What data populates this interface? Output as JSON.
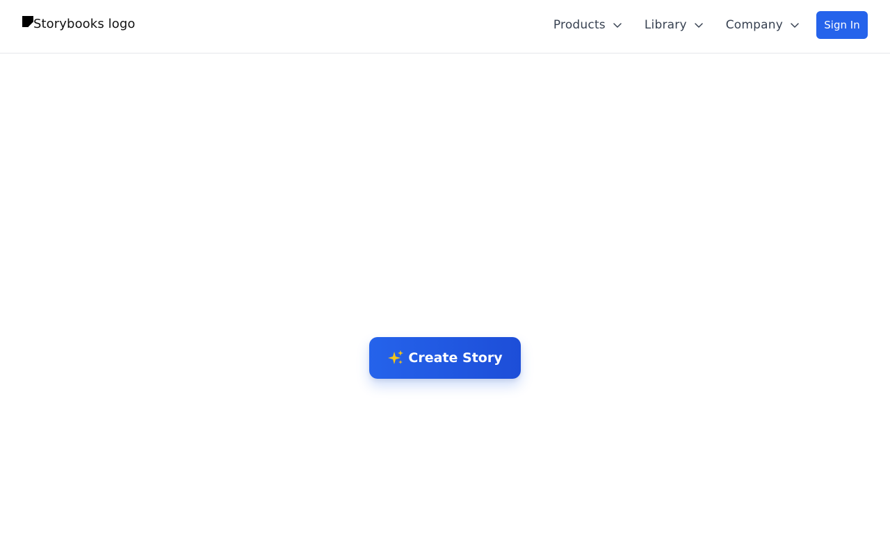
{
  "header": {
    "logo_alt": "Storybooks logo",
    "logo_icon": "broken-image-icon",
    "nav": [
      {
        "label": "Products",
        "icon": "chevron-down-icon"
      },
      {
        "label": "Library",
        "icon": "chevron-down-icon"
      },
      {
        "label": "Company",
        "icon": "chevron-down-icon"
      }
    ],
    "signin_label": "Sign In"
  },
  "main": {
    "cta_icon": "sparkles-icon",
    "cta_label": "Create Story"
  },
  "colors": {
    "accent": "#2563eb",
    "accent_dark": "#1d4ed8",
    "nav_text": "#374151",
    "border": "#e5e7eb",
    "sparkle": "#f5c518"
  }
}
